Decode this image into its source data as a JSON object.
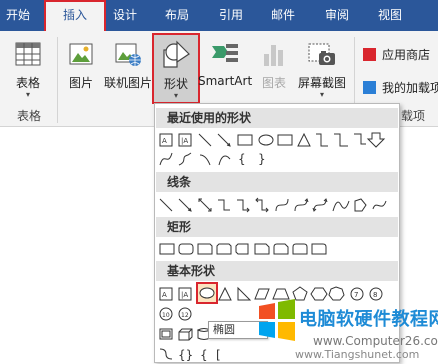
{
  "tabs": [
    "开始",
    "插入",
    "设计",
    "布局",
    "引用",
    "邮件",
    "审阅",
    "视图"
  ],
  "active_tab": "插入",
  "ribbon": {
    "table_label": "表格",
    "picture_label": "图片",
    "online_picture_label": "联机图片",
    "shapes_label": "形状",
    "smartart_label": "SmartArt",
    "chart_label": "图表",
    "screenshot_label": "屏幕截图",
    "group_tables": "表格",
    "app_store_label": "应用商店",
    "my_addins_label": "我的加载项",
    "addins_group_partial": "载项"
  },
  "shapes_menu": {
    "recent_label": "最近使用的形状",
    "lines_label": "线条",
    "rect_label": "矩形",
    "basic_label": "基本形状",
    "tooltip": "椭圆"
  },
  "watermark": {
    "title": "电脑软硬件教程网",
    "url": "www.Computer26.com",
    "url2": "www.Tiangshunet.com"
  },
  "colors": {
    "tab_bar": "#2b579a",
    "highlight": "#d9262e",
    "ribbon_bg": "#f3f3f3"
  }
}
